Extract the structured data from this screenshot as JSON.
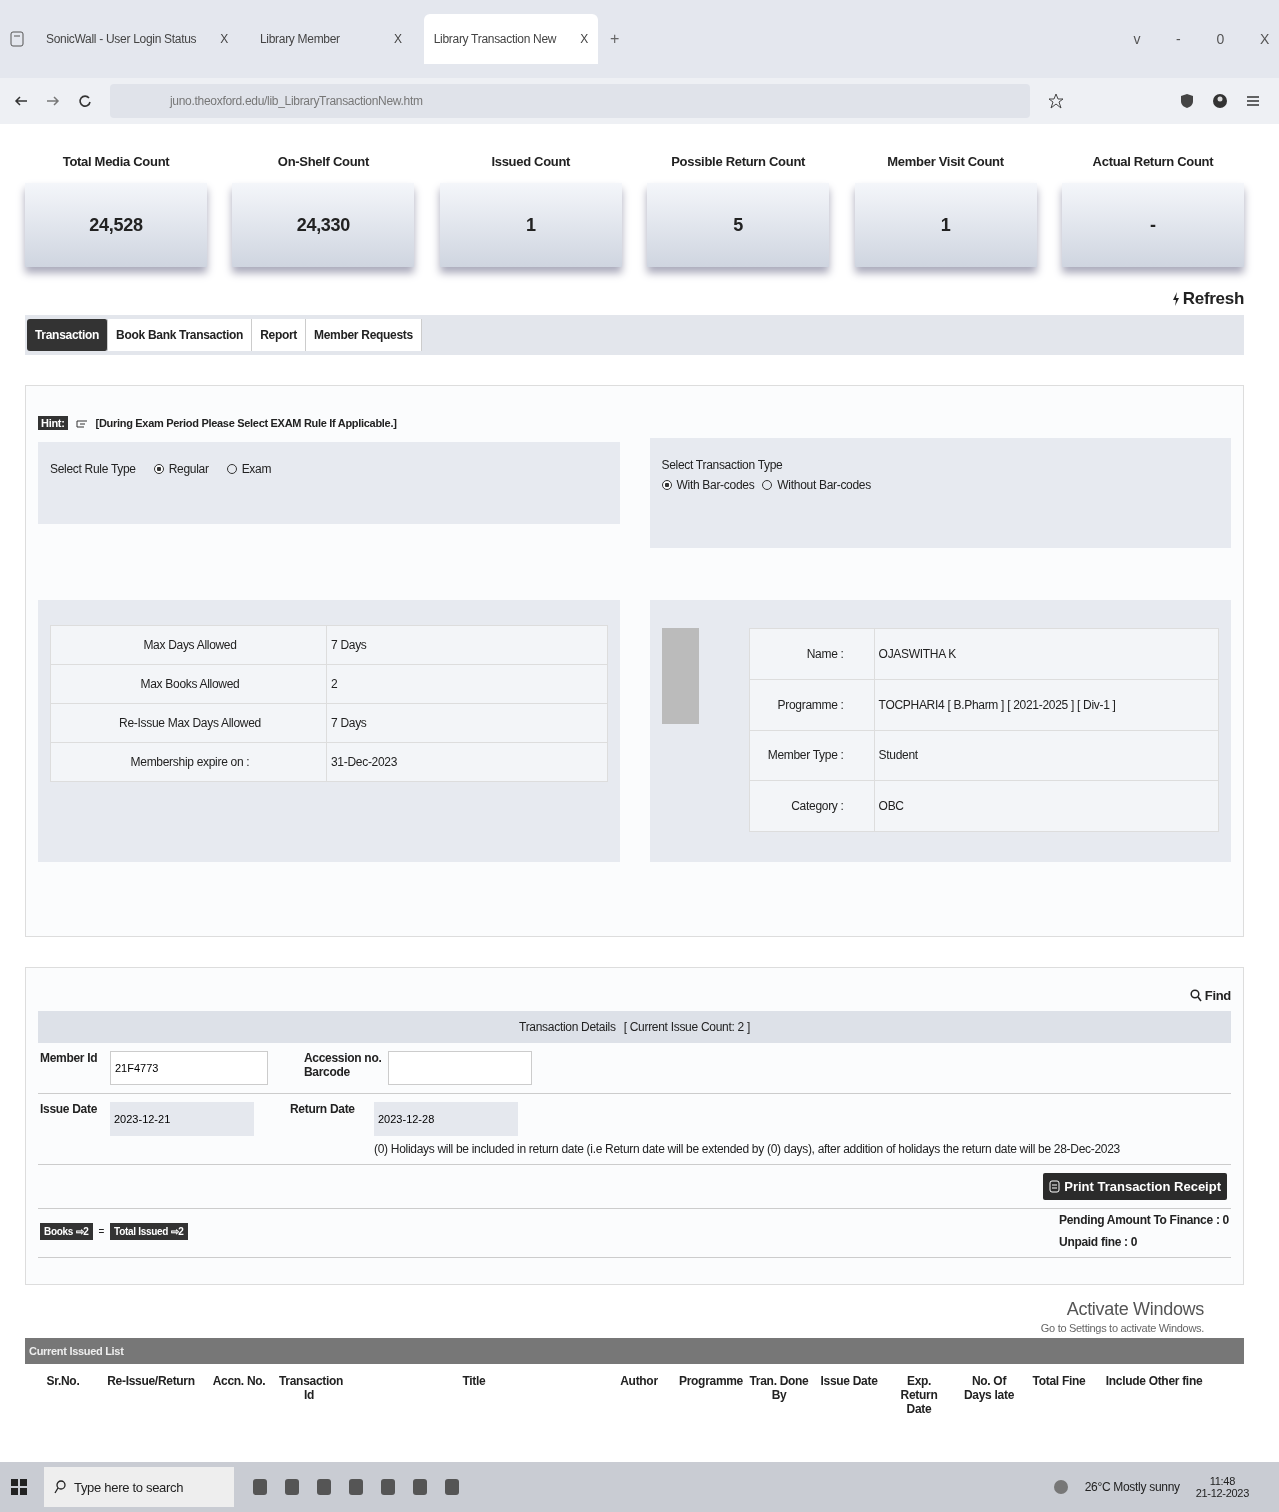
{
  "browser": {
    "tabs": [
      {
        "label": "SonicWall - User Login Status",
        "close": "X",
        "selected": false
      },
      {
        "label": "Library Member",
        "close": "X",
        "selected": false
      },
      {
        "label": "Library Transaction New",
        "close": "X",
        "selected": true
      }
    ],
    "new_tab": "+",
    "window_buttons": [
      "v",
      "-",
      "0",
      "X"
    ],
    "url": "juno.theoxford.edu/lib_LibraryTransactionNew.htm"
  },
  "stats": [
    {
      "label": "Total Media Count",
      "value": "24,528"
    },
    {
      "label": "On-Shelf Count",
      "value": "24,330"
    },
    {
      "label": "Issued Count",
      "value": "1"
    },
    {
      "label": "Possible Return Count",
      "value": "5"
    },
    {
      "label": "Member Visit Count",
      "value": "1"
    },
    {
      "label": "Actual Return Count",
      "value": "-"
    }
  ],
  "refresh": "Refresh",
  "tabs": [
    {
      "label": "Transaction",
      "selected": true
    },
    {
      "label": "Book Bank Transaction",
      "selected": false
    },
    {
      "label": "Report",
      "selected": false
    },
    {
      "label": "Member Requests",
      "selected": false
    }
  ],
  "hint": {
    "badge": "Hint:",
    "text": "[During Exam Period Please Select EXAM Rule If Applicable.]"
  },
  "rule_type": {
    "label": "Select Rule Type",
    "options": [
      {
        "label": "Regular",
        "selected": true
      },
      {
        "label": "Exam",
        "selected": false
      }
    ]
  },
  "transaction_type": {
    "label": "Select Transaction Type",
    "options": [
      {
        "label": "With Bar-codes",
        "selected": true
      },
      {
        "label": "Without Bar-codes",
        "selected": false
      }
    ]
  },
  "limits": [
    {
      "label": "Max Days Allowed",
      "value": "7 Days"
    },
    {
      "label": "Max Books Allowed",
      "value": "2"
    },
    {
      "label": "Re-Issue Max Days Allowed",
      "value": "7 Days"
    },
    {
      "label": "Membership expire on :",
      "value": "31-Dec-2023"
    }
  ],
  "member": [
    {
      "label": "Name :",
      "value": "OJASWITHA K"
    },
    {
      "label": "Programme :",
      "value": "TOCPHARI4 [ B.Pharm ] [ 2021-2025 ] [ Div-1 ]"
    },
    {
      "label": "Member Type :",
      "value": "Student"
    },
    {
      "label": "Category :",
      "value": "OBC"
    }
  ],
  "find": "Find",
  "details": {
    "title": "Transaction Details",
    "count": "[ Current Issue Count: 2 ]",
    "member_id_label": "Member Id",
    "member_id": "21F4773",
    "accession_label": "Accession no. Barcode",
    "issue_date_label": "Issue Date",
    "issue_date": "2023-12-21",
    "return_date_label": "Return Date",
    "return_date": "2023-12-28",
    "note": "(0) Holidays will be included in return date (i.e Return date will be extended by (0) days), after addition of holidays the return date will be 28-Dec-2023",
    "print": "Print Transaction Receipt",
    "books_badge": "Books ⇨2",
    "equals": "=",
    "total_badge": "Total Issued ⇨2",
    "pending": "Pending Amount To Finance : 0",
    "unpaid": "Unpaid fine : 0"
  },
  "activation": {
    "title": "Activate Windows",
    "text": "Go to Settings to activate Windows."
  },
  "issued_list": {
    "title": "Current Issued List",
    "columns": [
      "Sr.No.",
      "Re-Issue/Return",
      "Accn. No.",
      "Transaction Id",
      "Title",
      "Author",
      "Programme",
      "Tran. Done By",
      "Issue Date",
      "Exp. Return Date",
      "No. Of Days late",
      "Total Fine",
      "Include Other fine"
    ]
  },
  "taskbar": {
    "search": "Type here to search",
    "weather": "26°C Mostly sunny",
    "time": "11:48",
    "date": "21-12-2023"
  }
}
